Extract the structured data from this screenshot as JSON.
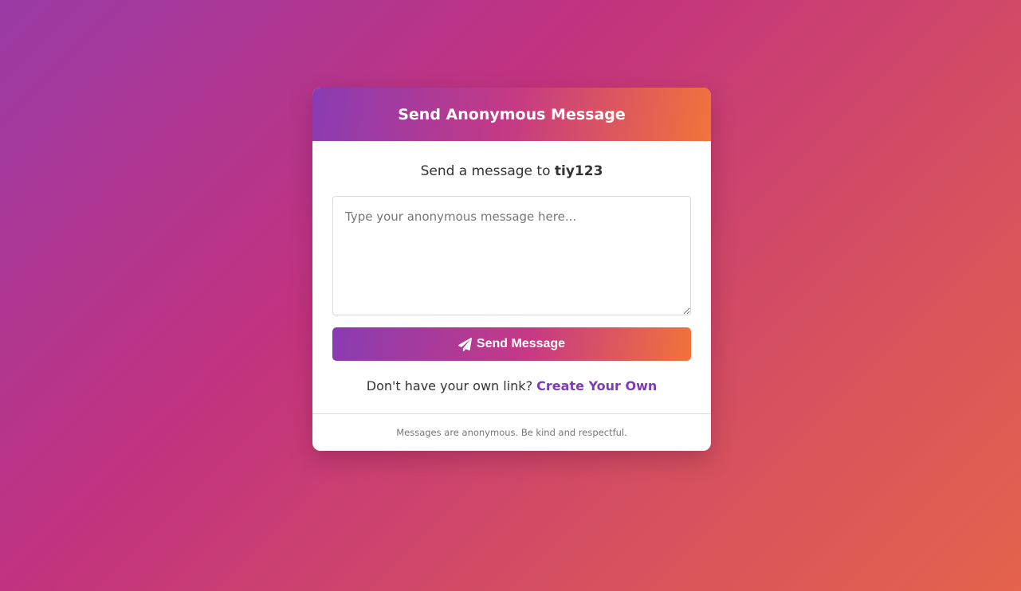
{
  "header": {
    "title": "Send Anonymous Message"
  },
  "recipient": {
    "prefix": "Send a message to",
    "username": "tiy123"
  },
  "message_input": {
    "placeholder": "Type your anonymous message here...",
    "value": ""
  },
  "send_button": {
    "label": "Send Message",
    "icon": "paper-plane-icon"
  },
  "create": {
    "prompt": "Don't have your own link?",
    "link_label": "Create Your Own"
  },
  "footer": {
    "note": "Messages are anonymous. Be kind and respectful."
  },
  "colors": {
    "accent_purple": "#8a3bb3",
    "accent_orange": "#f2733a",
    "link": "#7f3bb3"
  }
}
